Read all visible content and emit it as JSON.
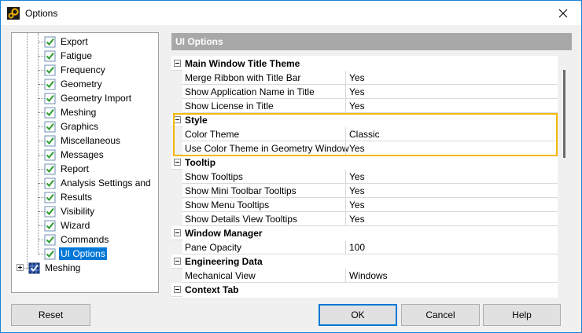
{
  "window": {
    "title": "Options",
    "app_icon": "gears-icon",
    "close_icon": "close-icon"
  },
  "tree": {
    "children": [
      {
        "label": "Export"
      },
      {
        "label": "Fatigue"
      },
      {
        "label": "Frequency"
      },
      {
        "label": "Geometry"
      },
      {
        "label": "Geometry Import"
      },
      {
        "label": "Meshing"
      },
      {
        "label": "Graphics"
      },
      {
        "label": "Miscellaneous"
      },
      {
        "label": "Messages"
      },
      {
        "label": "Report"
      },
      {
        "label": "Analysis Settings and"
      },
      {
        "label": "Results"
      },
      {
        "label": "Visibility"
      },
      {
        "label": "Wizard"
      },
      {
        "label": "Commands"
      },
      {
        "label": "UI Options",
        "selected": true
      }
    ],
    "root_node": {
      "label": "Meshing"
    }
  },
  "panel": {
    "header": "UI Options"
  },
  "grid": {
    "rows": [
      {
        "kind": "cat",
        "label": "Main Window Title Theme"
      },
      {
        "kind": "prop",
        "name": "Merge Ribbon with Title Bar",
        "value": "Yes"
      },
      {
        "kind": "prop",
        "name": "Show Application Name in Title",
        "value": "Yes"
      },
      {
        "kind": "prop",
        "name": "Show License in Title",
        "value": "Yes"
      },
      {
        "kind": "cat",
        "label": "Style"
      },
      {
        "kind": "prop",
        "name": "Color Theme",
        "value": "Classic"
      },
      {
        "kind": "prop",
        "name": "Use Color Theme in Geometry Window",
        "value": "Yes"
      },
      {
        "kind": "cat",
        "label": "Tooltip"
      },
      {
        "kind": "prop",
        "name": "Show Tooltips",
        "value": "Yes"
      },
      {
        "kind": "prop",
        "name": "Show Mini Toolbar Tooltips",
        "value": "Yes"
      },
      {
        "kind": "prop",
        "name": "Show Menu Tooltips",
        "value": "Yes"
      },
      {
        "kind": "prop",
        "name": "Show Details View Tooltips",
        "value": "Yes"
      },
      {
        "kind": "cat",
        "label": "Window Manager"
      },
      {
        "kind": "prop",
        "name": "Pane Opacity",
        "value": "100"
      },
      {
        "kind": "cat",
        "label": "Engineering Data"
      },
      {
        "kind": "prop",
        "name": "Mechanical View",
        "value": "Windows"
      },
      {
        "kind": "cat",
        "label": "Context Tab"
      }
    ]
  },
  "buttons": {
    "reset": "Reset",
    "ok": "OK",
    "cancel": "Cancel",
    "help": "Help"
  },
  "colors": {
    "accent": "#0078d7",
    "highlight": "#f5b800",
    "check": "#2e9e2e"
  }
}
